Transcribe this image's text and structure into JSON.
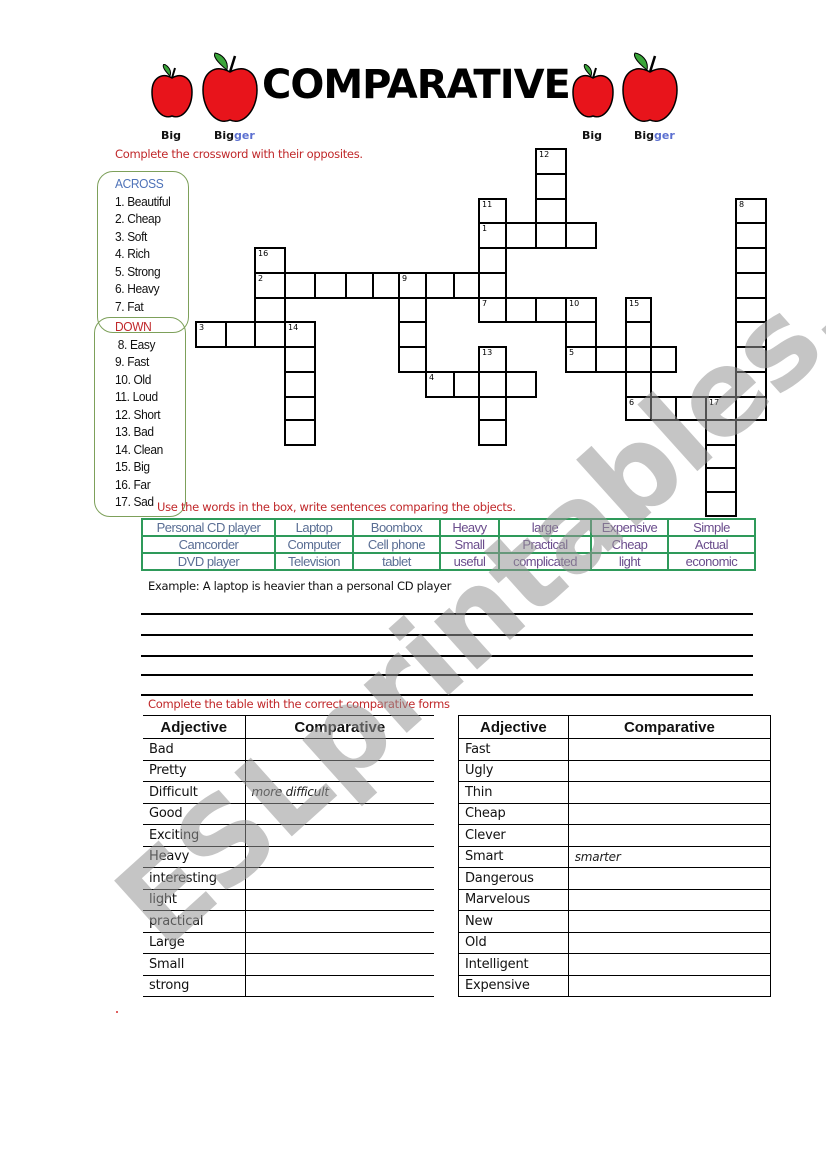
{
  "header": {
    "title": "COMPARATIVE",
    "apple_labels": [
      {
        "base": "Big",
        "suffix": ""
      },
      {
        "base": "Big",
        "suffix": "ger"
      },
      {
        "base": "Big",
        "suffix": ""
      },
      {
        "base": "Big",
        "suffix": "ger"
      }
    ]
  },
  "crossword": {
    "instruction": "Complete the crossword with their opposites.",
    "across_heading": "ACROSS",
    "across": [
      "1. Beautiful",
      "2. Cheap",
      "3. Soft",
      "4. Rich",
      "5. Strong",
      "6. Heavy",
      "7. Fat"
    ],
    "down_heading": "DOWN",
    "down": [
      "8. Easy",
      "9. Fast",
      "10. Old",
      "11. Loud",
      "12. Short",
      "13. Bad",
      "14. Clean",
      "15. Big",
      "16. Far",
      "17. Sad"
    ],
    "entries": [
      {
        "number": "1",
        "direction": "across",
        "row": 3,
        "col": 10,
        "length": 4
      },
      {
        "number": "2",
        "direction": "across",
        "row": 5,
        "col": 2,
        "length": 9
      },
      {
        "number": "3",
        "direction": "across",
        "row": 7,
        "col": 0,
        "length": 4
      },
      {
        "number": "4",
        "direction": "across",
        "row": 9,
        "col": 8,
        "length": 4
      },
      {
        "number": "5",
        "direction": "across",
        "row": 8,
        "col": 13,
        "length": 4
      },
      {
        "number": "6",
        "direction": "across",
        "row": 10,
        "col": 15,
        "length": 5
      },
      {
        "number": "7",
        "direction": "across",
        "row": 6,
        "col": 10,
        "length": 4
      },
      {
        "number": "8",
        "direction": "down",
        "row": 2,
        "col": 19,
        "length": 9
      },
      {
        "number": "9",
        "direction": "down",
        "row": 5,
        "col": 7,
        "length": 4
      },
      {
        "number": "10",
        "direction": "down",
        "row": 6,
        "col": 13,
        "length": 3
      },
      {
        "number": "11",
        "direction": "down",
        "row": 2,
        "col": 10,
        "length": 5
      },
      {
        "number": "12",
        "direction": "down",
        "row": 0,
        "col": 12,
        "length": 4
      },
      {
        "number": "13",
        "direction": "down",
        "row": 8,
        "col": 10,
        "length": 4
      },
      {
        "number": "14",
        "direction": "down",
        "row": 7,
        "col": 3,
        "length": 5
      },
      {
        "number": "15",
        "direction": "down",
        "row": 6,
        "col": 15,
        "length": 5
      },
      {
        "number": "16",
        "direction": "down",
        "row": 4,
        "col": 2,
        "length": 4
      },
      {
        "number": "17",
        "direction": "down",
        "row": 10,
        "col": 18,
        "length": 5
      }
    ]
  },
  "word_box": {
    "instruction": "Use the words in the box, write sentences comparing the objects.",
    "rows": [
      [
        "Personal CD player",
        "Laptop",
        "Boombox",
        "Heavy",
        "large",
        "Expensive",
        "Simple"
      ],
      [
        "Camcorder",
        "Computer",
        "Cell phone",
        "Small",
        "Practical",
        "Cheap",
        "Actual"
      ],
      [
        "DVD player",
        "Television",
        "tablet",
        "useful",
        "complicated",
        "light",
        "economic"
      ]
    ],
    "example": "Example: A laptop is heavier than a personal CD player",
    "colors": {
      "nouns": "#5a6e94",
      "adjectives": "#6a4c8c",
      "border": "#2e9a5a"
    }
  },
  "comparative_tables": {
    "instruction": "Complete the table with the correct comparative forms",
    "headers": [
      "Adjective",
      "Comparative"
    ],
    "left": [
      {
        "adjective": "Bad",
        "comparative": ""
      },
      {
        "adjective": "Pretty",
        "comparative": ""
      },
      {
        "adjective": "Difficult",
        "comparative": "more difficult"
      },
      {
        "adjective": "Good",
        "comparative": ""
      },
      {
        "adjective": "Exciting",
        "comparative": ""
      },
      {
        "adjective": "Heavy",
        "comparative": ""
      },
      {
        "adjective": "interesting",
        "comparative": ""
      },
      {
        "adjective": "light",
        "comparative": ""
      },
      {
        "adjective": "practical",
        "comparative": ""
      },
      {
        "adjective": "Large",
        "comparative": ""
      },
      {
        "adjective": "Small",
        "comparative": ""
      },
      {
        "adjective": "strong",
        "comparative": ""
      }
    ],
    "right": [
      {
        "adjective": "Fast",
        "comparative": ""
      },
      {
        "adjective": "Ugly",
        "comparative": ""
      },
      {
        "adjective": "Thin",
        "comparative": ""
      },
      {
        "adjective": "Cheap",
        "comparative": ""
      },
      {
        "adjective": "Clever",
        "comparative": ""
      },
      {
        "adjective": "Smart",
        "comparative": "smarter"
      },
      {
        "adjective": "Dangerous",
        "comparative": ""
      },
      {
        "adjective": "Marvelous",
        "comparative": ""
      },
      {
        "adjective": "New",
        "comparative": ""
      },
      {
        "adjective": "Old",
        "comparative": ""
      },
      {
        "adjective": "Intelligent",
        "comparative": ""
      },
      {
        "adjective": "Expensive",
        "comparative": ""
      }
    ]
  },
  "watermark": "ESLprintables.com",
  "colors": {
    "instruction_red": "#c0282a",
    "across_blue": "#4e72b8",
    "clue_box_green": "#7da05a",
    "apple_red": "#e8141b",
    "leaf_green": "#3aa53a"
  }
}
